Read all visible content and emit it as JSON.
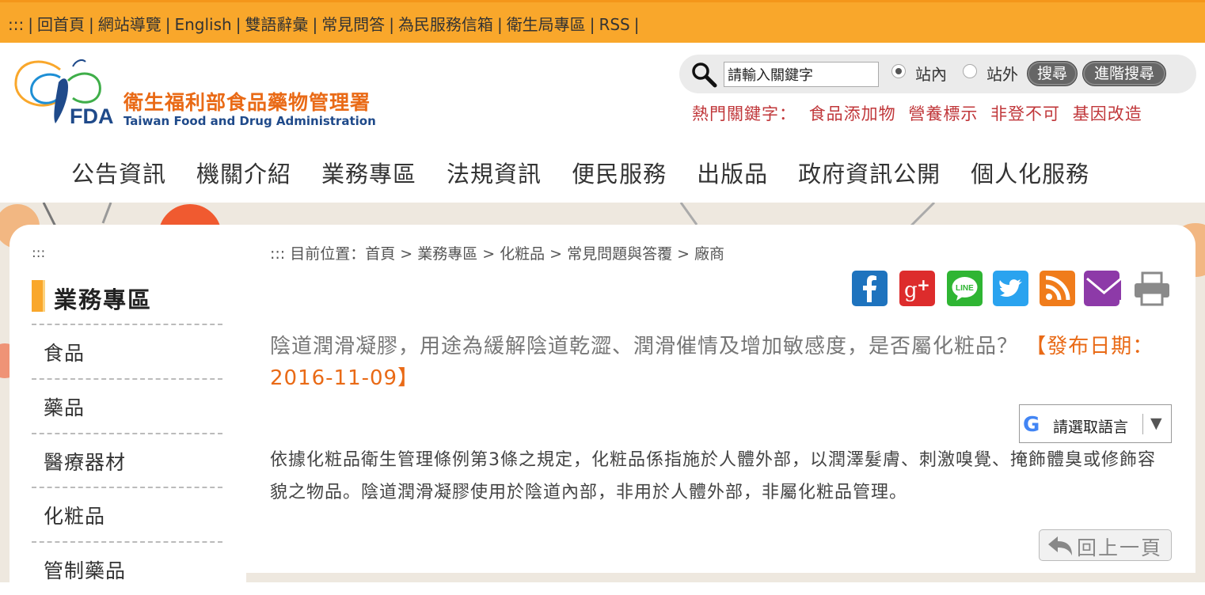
{
  "topbar": {
    "accesskey": ":::",
    "links": [
      "回首頁",
      "網站導覽",
      "English",
      "雙語辭彙",
      "常見問答",
      "為民服務信箱",
      "衛生局專區",
      "RSS"
    ]
  },
  "logo": {
    "name_cn": "衛生福利部食品藥物管理署",
    "name_en": "Taiwan Food and Drug Administration",
    "mark_text": "FDA"
  },
  "search": {
    "placeholder": "請輸入關鍵字",
    "value": "請輸入關鍵字",
    "scope_internal": "站內",
    "scope_external": "站外",
    "selected_scope": "站內",
    "search_button": "搜尋",
    "advanced_button": "進階搜尋",
    "hot_label": "熱門關鍵字：",
    "hot_keywords": [
      "食品添加物",
      "營養標示",
      "非登不可",
      "基因改造"
    ]
  },
  "mainnav": [
    "公告資訊",
    "機關介紹",
    "業務專區",
    "法規資訊",
    "便民服務",
    "出版品",
    "政府資訊公開",
    "個人化服務"
  ],
  "sidebar": {
    "accesskey": ":::",
    "title": "業務專區",
    "items": [
      "食品",
      "藥品",
      "醫療器材",
      "化粧品",
      "管制藥品"
    ]
  },
  "breadcrumb": {
    "accesskey": ":::",
    "label": "目前位置：",
    "path": [
      "首頁",
      "業務專區",
      "化粧品",
      "常見問題與答覆",
      "廠商"
    ],
    "separator": ">"
  },
  "share_icons": [
    {
      "name": "facebook-icon",
      "color": "#1e73be"
    },
    {
      "name": "google-plus-icon",
      "color": "#dd2c2c"
    },
    {
      "name": "line-icon",
      "color": "#2fb533"
    },
    {
      "name": "twitter-icon",
      "color": "#2aa3ef"
    },
    {
      "name": "rss-icon",
      "color": "#f07c1b"
    },
    {
      "name": "email-icon",
      "color": "#8d3aa8"
    },
    {
      "name": "print-icon",
      "color": "#8a8a8a"
    }
  ],
  "article": {
    "question": "陰道潤滑凝膠，用途為緩解陰道乾澀、潤滑催情及增加敏感度，是否屬化粧品？",
    "date_text": "【發布日期：2016-11-09】",
    "answer": "依據化粧品衛生管理條例第3條之規定，化粧品係指施於人體外部，以潤澤髮膚、刺激嗅覺、掩飾體臭或修飾容貌之物品。陰道潤滑凝膠使用於陰道內部，非用於人體外部，非屬化粧品管理。"
  },
  "translate": {
    "label": "請選取語言",
    "arrow": "▼",
    "g": "G"
  },
  "back_button": "回上一頁",
  "colors": {
    "topbar": "#f9a72b",
    "accent_orange": "#e96a16",
    "hot_red": "#c0373a"
  }
}
